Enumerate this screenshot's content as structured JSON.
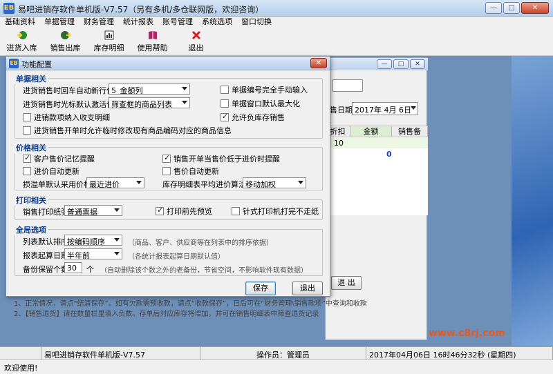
{
  "app": {
    "title": "易吧进销存软件单机版-V7.57（另有多机/多仓联网版，欢迎咨询）",
    "icon_text": "EB"
  },
  "window_controls": {
    "minimize": "—",
    "maximize": "□",
    "close": "✕"
  },
  "menu": [
    "基础资料",
    "单据管理",
    "财务管理",
    "统计报表",
    "账号管理",
    "系统选项",
    "窗口切换"
  ],
  "toolbar": [
    {
      "label": "进货入库",
      "icon": "inbound-icon",
      "color": "#2d8a2d"
    },
    {
      "label": "销售出库",
      "icon": "outbound-icon",
      "color": "#2d6a2d"
    },
    {
      "label": "库存明细",
      "icon": "inventory-icon",
      "color": "#3a3a3a"
    },
    {
      "label": "使用帮助",
      "icon": "help-book-icon",
      "color": "#b3236b"
    },
    {
      "label": "退出",
      "icon": "exit-x-icon",
      "color": "#d21f1f"
    }
  ],
  "background_window": {
    "date_label": "售日期",
    "date_value": "2017年 4月 6日",
    "columns": [
      "折扣",
      "金额",
      "销售备"
    ],
    "row1_discount": "10",
    "row2_amount": "0",
    "exit_label": "退 出"
  },
  "notes": [
    "1、正常情况，请点“结清保存”。如有欠款需预收款，请点“收款保存”，日后可在“财务管理\\销售款项”中查询和收款",
    "2、【销售退货】请在数量栏里填入负数。存单后对应库存将增加，并可在销售明细表中筛查退货记录"
  ],
  "dialog": {
    "title": "功能配置",
    "icon_text": "EB",
    "close": "✕",
    "doc_group": {
      "title": "单据相关",
      "enter_label": "进货销售时回车自动新行位置",
      "enter_value": "5_金额列",
      "cursor_label": "进货销售时光标默认激活位置",
      "cursor_value": "筛查框的商品列表",
      "cb_receipt": "进销款项纳入收支明细",
      "cb_modify": "进货销售开单时允许临时修改现有商品编码对应的商品信息",
      "cb_manual_no": "单据编号完全手动输入",
      "cb_maximize": "单据窗口默认最大化",
      "cb_negative": "允许负库存销售"
    },
    "price_group": {
      "title": "价格相关",
      "cb_remember": "客户售价记忆提醒",
      "cb_auto_purchase": "进价自动更新",
      "cb_below_cost": "销售开单当售价低于进价时提醒",
      "cb_auto_sale": "售价自动更新",
      "loss_label": "损溢单默认采用价格",
      "loss_value": "最近进价",
      "avg_label": "库存明细表平均进价算法",
      "avg_value": "移动加权"
    },
    "print_group": {
      "title": "打印相关",
      "paper_label": "销售打印纸张",
      "paper_value": "普通票据",
      "cb_preview": "打印前先预览",
      "cb_needle": "针式打印机打完不走纸"
    },
    "global_group": {
      "title": "全局选项",
      "sort_label": "列表默认排序",
      "sort_value": "按编码顺序",
      "sort_hint": "（商品、客户、供应商等在列表中的排序依据）",
      "report_label": "报表起算日期",
      "report_value": "半年前",
      "report_hint": "（各统计报表起算日期默认值）",
      "backup_label": "备份保留个数",
      "backup_value": "30",
      "backup_unit": "个",
      "backup_hint": "（自动删除该个数之外的老备份，节省空间，不影响软件现有数据）"
    },
    "save_label": "保存",
    "exit_label": "退出"
  },
  "statusbar": {
    "app_name": "易吧进销存软件单机版-V7.57",
    "operator": "操作员：管理员",
    "datetime": "2017年04月06日  16时46分32秒  (星期四)"
  },
  "bottom_text": "欢迎使用!",
  "watermark": "www.c8rj.com"
}
